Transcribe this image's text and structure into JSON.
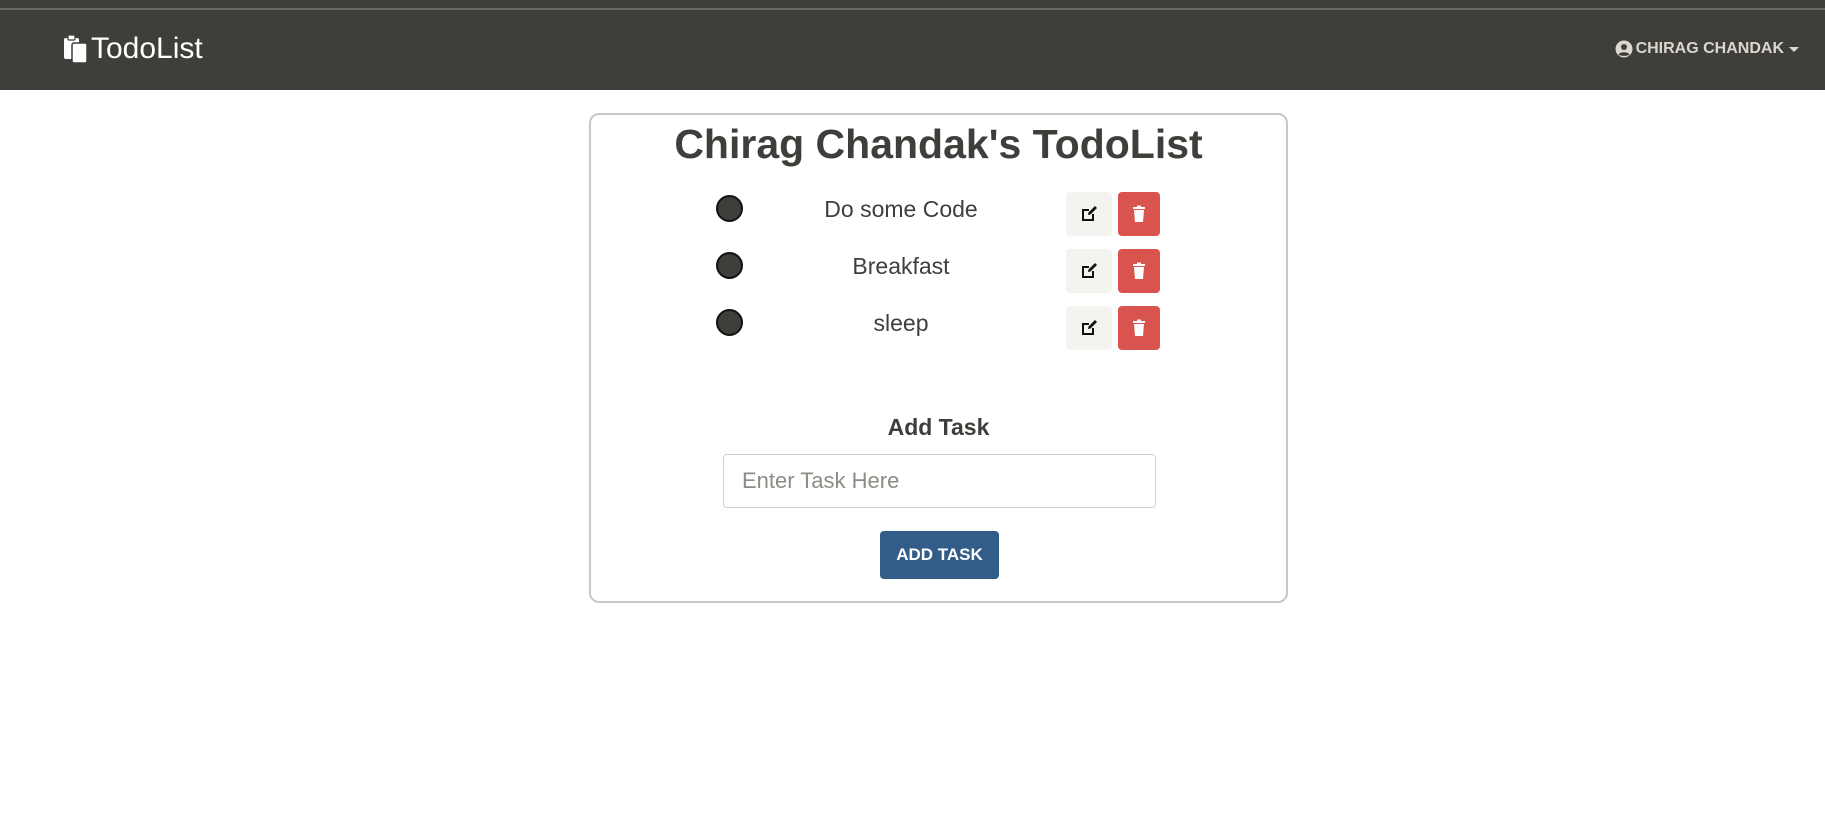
{
  "navbar": {
    "brand": "TodoList",
    "user": "CHIRAG CHANDAK"
  },
  "main": {
    "title": "Chirag Chandak's TodoList",
    "tasks": [
      {
        "text": "Do some Code"
      },
      {
        "text": "Breakfast"
      },
      {
        "text": "sleep"
      }
    ],
    "add_title": "Add Task",
    "input_placeholder": "Enter Task Here",
    "input_value": "",
    "add_button": "ADD TASK"
  },
  "colors": {
    "navbar": "#3e3f3a",
    "delete": "#d9534f",
    "primary": "#325d88",
    "edit_bg": "#f5f3ef"
  },
  "icons": {
    "brand": "clipboard-icon",
    "user": "user-circle-icon",
    "edit": "edit-icon",
    "delete": "trash-icon"
  }
}
